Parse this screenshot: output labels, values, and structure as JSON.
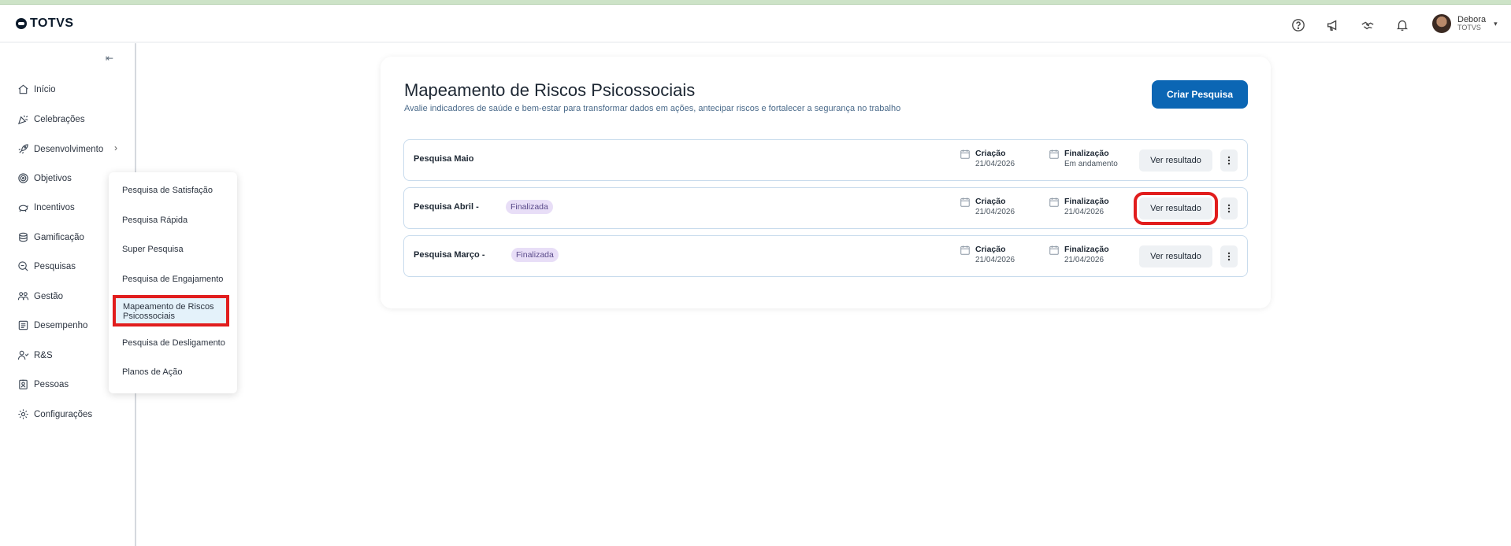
{
  "header": {
    "logo": "TOTVS",
    "icons": [
      "help-icon",
      "megaphone-icon",
      "handshake-icon",
      "bell-icon"
    ],
    "user": {
      "name": "Debora",
      "org": "TOTVS"
    }
  },
  "sidebar": {
    "items": [
      {
        "label": "Início",
        "icon": "home-icon"
      },
      {
        "label": "Celebrações",
        "icon": "party-icon"
      },
      {
        "label": "Desenvolvimento",
        "icon": "rocket-icon"
      },
      {
        "label": "Objetivos",
        "icon": "target-icon"
      },
      {
        "label": "Incentivos",
        "icon": "piggy-bank-icon"
      },
      {
        "label": "Gamificação",
        "icon": "coins-icon"
      },
      {
        "label": "Pesquisas",
        "icon": "search-survey-icon"
      },
      {
        "label": "Gestão",
        "icon": "team-icon"
      },
      {
        "label": "Desempenho",
        "icon": "performance-icon"
      },
      {
        "label": "R&S",
        "icon": "users-icon"
      },
      {
        "label": "Pessoas",
        "icon": "badge-icon"
      },
      {
        "label": "Configurações",
        "icon": "gear-icon"
      }
    ]
  },
  "submenu": {
    "items": [
      "Pesquisa de Satisfação",
      "Pesquisa Rápida",
      "Super Pesquisa",
      "Pesquisa de Engajamento",
      "Mapeamento de Riscos Psicossociais",
      "Pesquisa de Desligamento",
      "Planos de Ação"
    ],
    "active": "Mapeamento de Riscos Psicossociais"
  },
  "main": {
    "title": "Mapeamento de Riscos Psicossociais",
    "subtitle": "Avalie indicadores de saúde e bem-estar para transformar dados em ações, antecipar riscos e fortalecer a segurança no trabalho",
    "create_button": "Criar Pesquisa",
    "surveys": [
      {
        "name": "Pesquisa Maio",
        "status": "",
        "created_label": "Criação",
        "created": "21/04/2026",
        "end_label": "Finalização",
        "end": "Em andamento",
        "action": "Ver resultado"
      },
      {
        "name": "Pesquisa Abril -",
        "status": "Finalizada",
        "created_label": "Criação",
        "created": "21/04/2026",
        "end_label": "Finalização",
        "end": "21/04/2026",
        "action": "Ver resultado"
      },
      {
        "name": "Pesquisa Março -",
        "status": "Finalizada",
        "created_label": "Criação",
        "created": "21/04/2026",
        "end_label": "Finalização",
        "end": "21/04/2026",
        "action": "Ver resultado"
      }
    ]
  },
  "colors": {
    "primary": "#0b66b4",
    "highlight": "#e11d1d",
    "badge": "#e8def7"
  }
}
